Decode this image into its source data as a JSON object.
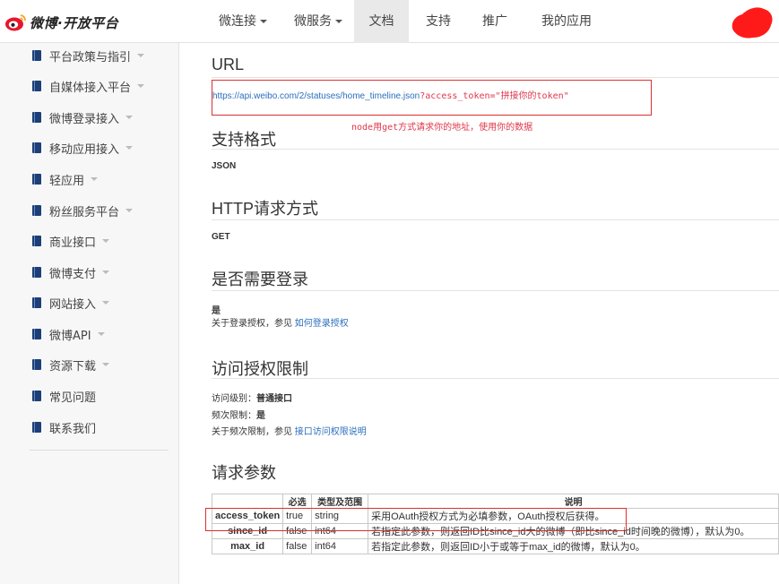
{
  "brand": {
    "logo_text": "微博·开放平台"
  },
  "topnav": {
    "items": [
      {
        "label": "微连接",
        "dropdown": true
      },
      {
        "label": "微服务",
        "dropdown": true
      },
      {
        "label": "文档",
        "dropdown": false,
        "active": true
      },
      {
        "label": "支持",
        "dropdown": false
      },
      {
        "label": "推广",
        "dropdown": false
      },
      {
        "label": "我的应用",
        "dropdown": false
      }
    ]
  },
  "sidebar": {
    "items": [
      {
        "label": "平台政策与指引",
        "expandable": true
      },
      {
        "label": "自媒体接入平台",
        "expandable": true
      },
      {
        "label": "微博登录接入",
        "expandable": true
      },
      {
        "label": "移动应用接入",
        "expandable": true
      },
      {
        "label": "轻应用",
        "expandable": true
      },
      {
        "label": "粉丝服务平台",
        "expandable": true
      },
      {
        "label": "商业接口",
        "expandable": true
      },
      {
        "label": "微博支付",
        "expandable": true
      },
      {
        "label": "网站接入",
        "expandable": true
      },
      {
        "label": "微博API",
        "expandable": true
      },
      {
        "label": "资源下载",
        "expandable": true
      },
      {
        "label": "常见问题",
        "expandable": false
      },
      {
        "label": "联系我们",
        "expandable": false
      }
    ]
  },
  "main": {
    "url_section": {
      "heading": "URL",
      "url": "https://api.weibo.com/2/statuses/home_timeline.json",
      "annotation_suffix": "?access_token=\"拼接你的token\"",
      "annotation_note": "node用get方式请求你的地址，使用你的数据"
    },
    "format_section": {
      "heading": "支持格式",
      "value": "JSON"
    },
    "http_section": {
      "heading": "HTTP请求方式",
      "value": "GET"
    },
    "login_section": {
      "heading": "是否需要登录",
      "value": "是",
      "note_prefix": "关于登录授权，参见 ",
      "note_link": "如何登录授权"
    },
    "limit_section": {
      "heading": "访问授权限制",
      "level_label": "访问级别：",
      "level_value": "普通接口",
      "freq_label": "频次限制：",
      "freq_value": "是",
      "note_prefix": "关于频次限制，参见 ",
      "note_link": "接口访问权限说明"
    },
    "params_section": {
      "heading": "请求参数",
      "columns": [
        "",
        "必选",
        "类型及范围",
        "说明"
      ],
      "rows": [
        {
          "name": "access_token",
          "required": "true",
          "type": "string",
          "desc": "采用OAuth授权方式为必填参数，OAuth授权后获得。"
        },
        {
          "name": "since_id",
          "required": "false",
          "type": "int64",
          "desc": "若指定此参数，则返回ID比since_id大的微博（即比since_id时间晚的微博），默认为0。"
        },
        {
          "name": "max_id",
          "required": "false",
          "type": "int64",
          "desc": "若指定此参数，则返回ID小于或等于max_id的微博，默认为0。"
        }
      ]
    }
  },
  "colors": {
    "annotation_red": "#dc2f2f",
    "link_blue": "#2a6ebd",
    "brand_red": "#e6162d"
  }
}
